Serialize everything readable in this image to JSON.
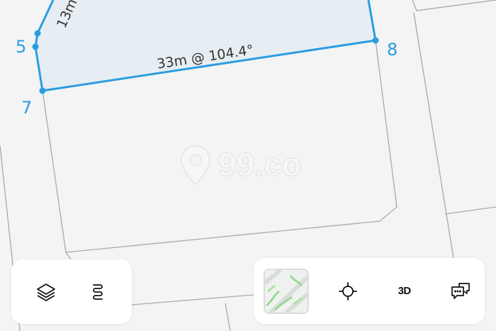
{
  "map": {
    "watermark_text": "99.co",
    "edge_labels": [
      {
        "id": "edge-5-top",
        "text": "13m"
      },
      {
        "id": "edge-7-8",
        "text": "33m @ 104.4°"
      }
    ],
    "vertices": [
      {
        "id": "5",
        "label": "5"
      },
      {
        "id": "7",
        "label": "7"
      },
      {
        "id": "8",
        "label": "8"
      }
    ]
  },
  "controls": {
    "left": [
      {
        "id": "layers",
        "icon": "layers-icon"
      },
      {
        "id": "measure",
        "icon": "squiggle-icon"
      }
    ],
    "right": {
      "map_style": {
        "icon": "map-thumbnail"
      },
      "locate": {
        "icon": "crosshair-icon"
      },
      "three_d": {
        "label": "3D"
      },
      "feedback": {
        "icon": "chat-bubbles-icon"
      }
    }
  },
  "colors": {
    "accent": "#2a9de0",
    "vertex_label": "#2a9de0",
    "parcel_fill": "#e7eef3",
    "road_line": "#a9a9a9",
    "background": "#f4f4f4"
  }
}
